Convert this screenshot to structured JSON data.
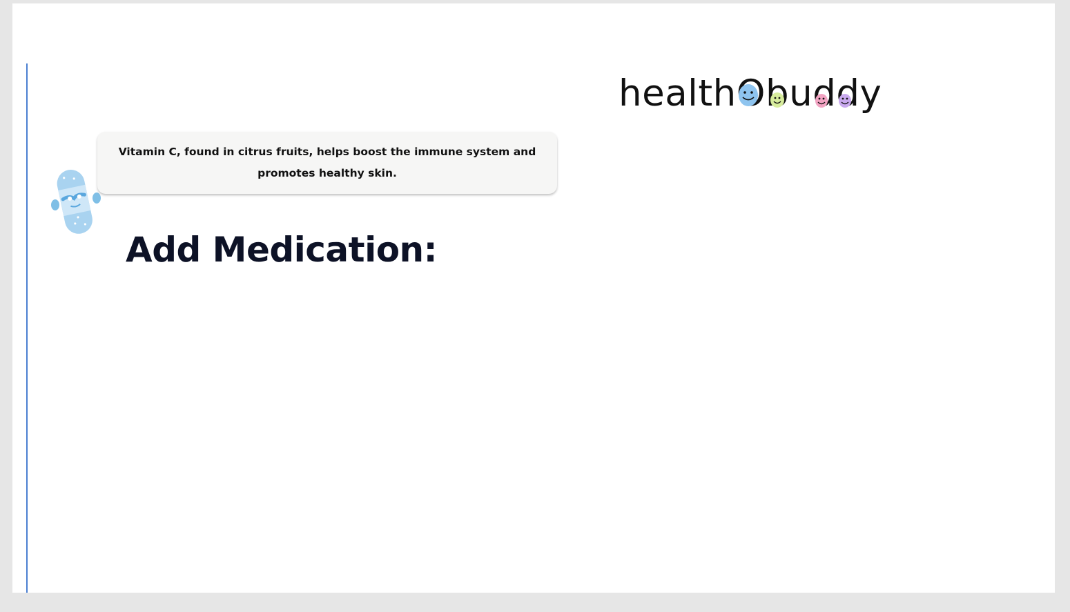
{
  "brand": {
    "logo_prefix": "health",
    "logo_o": "O",
    "logo_middle": "bu",
    "logo_d1": "d",
    "logo_d2": "d",
    "logo_suffix": "y",
    "face_colors": [
      "#8ec4ef",
      "#d7ec9c",
      "#f2a3c2",
      "#c9a9ee"
    ]
  },
  "tip": {
    "text": "Vitamin C, found in citrus fruits, helps boost the immune system and promotes healthy skin."
  },
  "main": {
    "heading": "Add Medication:"
  },
  "colors": {
    "accent_rule": "#4a7fd1",
    "bubble_bg": "#f6f6f5",
    "mascot": "#a9d3f0"
  },
  "icons": {
    "mascot": "bandage-mascot-icon"
  }
}
